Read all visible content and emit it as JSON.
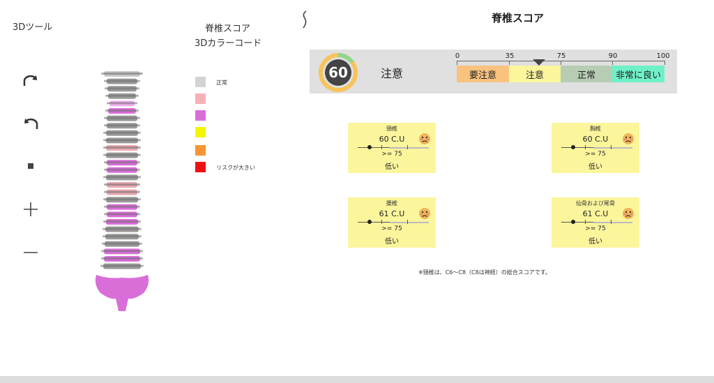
{
  "tools": {
    "title": "3Dツール",
    "items": [
      {
        "name": "rotate-right-icon"
      },
      {
        "name": "rotate-left-icon"
      },
      {
        "name": "reset-icon"
      },
      {
        "name": "zoom-in-icon"
      },
      {
        "name": "zoom-out-icon"
      }
    ]
  },
  "color_code": {
    "title_line1": "脊椎スコア",
    "title_line2": "3Dカラーコード",
    "swatches": [
      {
        "color": "#d3d3d3",
        "label": "正常"
      },
      {
        "color": "#f8b0b8",
        "label": ""
      },
      {
        "color": "#d96ed9",
        "label": ""
      },
      {
        "color": "#f5f500",
        "label": ""
      },
      {
        "color": "#f79535",
        "label": ""
      },
      {
        "color": "#ee1111",
        "label": "リスクが大きい"
      }
    ]
  },
  "score": {
    "title": "脊椎スコア",
    "value": "60",
    "status": "注意",
    "scale": {
      "ticks": [
        "0",
        "35",
        "75",
        "90",
        "100"
      ],
      "segments": [
        {
          "label": "要注意",
          "color": "#f9c27f"
        },
        {
          "label": "注意",
          "color": "#fbf59c"
        },
        {
          "label": "正常",
          "color": "#b6cdb4"
        },
        {
          "label": "非常に良い",
          "color": "#6ef0c8"
        }
      ]
    }
  },
  "cards": [
    {
      "title": "頸椎",
      "value": "60 C.U",
      "threshold": ">= 75",
      "level": "低い"
    },
    {
      "title": "胸椎",
      "value": "60 C.U",
      "threshold": ">= 75",
      "level": "低い"
    },
    {
      "title": "腰椎",
      "value": "61 C.U",
      "threshold": ">= 75",
      "level": "低い"
    },
    {
      "title": "仙骨および尾骨",
      "value": "61 C.U",
      "threshold": ">= 75",
      "level": "低い"
    }
  ],
  "footnote": "※頸椎は、C6～C8（C8は神経）の総合スコアです。",
  "colors": {
    "card_bg": "#fbf59c",
    "panel_bg": "#e0e0e0",
    "gauge_ring": "#f7c35a",
    "gauge_arc": "#8fd68f",
    "gauge_center": "#444444"
  }
}
